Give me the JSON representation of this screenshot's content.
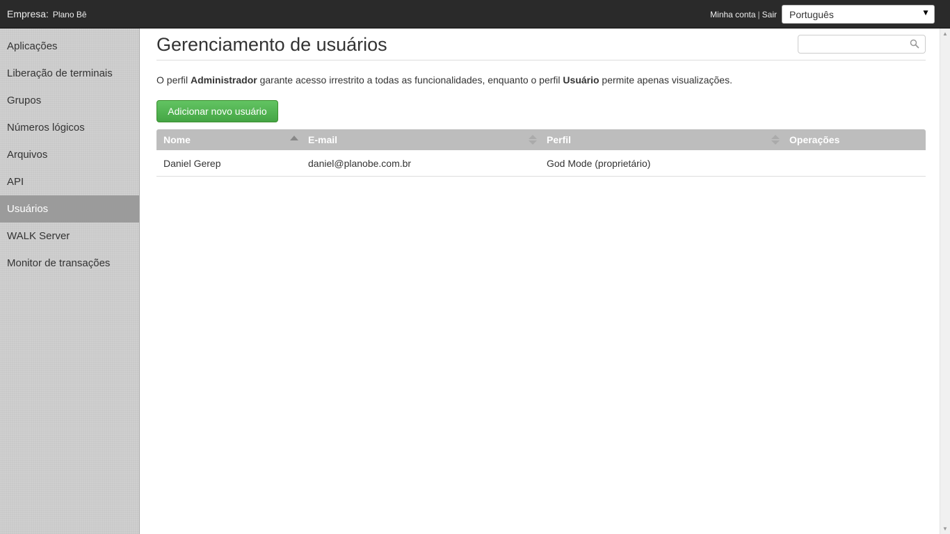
{
  "topbar": {
    "company_label": "Empresa:",
    "company_name": "Plano Bê",
    "my_account": "Minha conta",
    "separator": "|",
    "logout": "Sair",
    "language_value": "Português"
  },
  "sidebar": {
    "items": [
      {
        "label": "Aplicações"
      },
      {
        "label": "Liberação de terminais"
      },
      {
        "label": "Grupos"
      },
      {
        "label": "Números lógicos"
      },
      {
        "label": "Arquivos"
      },
      {
        "label": "API"
      },
      {
        "label": "Usuários",
        "active": true
      },
      {
        "label": "WALK Server"
      },
      {
        "label": "Monitor de transações"
      }
    ]
  },
  "main": {
    "title": "Gerenciamento de usuários",
    "search_placeholder": "",
    "description": {
      "p1": "O perfil ",
      "b1": "Administrador",
      "p2": " garante acesso irrestrito a todas as funcionalidades, enquanto o perfil ",
      "b2": "Usuário",
      "p3": " permite apenas visualizações."
    },
    "add_button": "Adicionar novo usuário",
    "table": {
      "headers": [
        "Nome",
        "E-mail",
        "Perfil",
        "Operações"
      ],
      "sort_state": [
        "ascending",
        "unsorted",
        "unsorted",
        "none"
      ],
      "rows": [
        {
          "nome": "Daniel Gerep",
          "email": "daniel@planobe.com.br",
          "perfil": "God Mode (proprietário)",
          "operacoes": ""
        }
      ]
    }
  },
  "colors": {
    "topbar": "#2a2a2a",
    "sidebar": "#c9c9c9",
    "sidebar_active": "#9b9b9b",
    "table_header": "#bdbdbd",
    "button_green": "#51b151"
  }
}
